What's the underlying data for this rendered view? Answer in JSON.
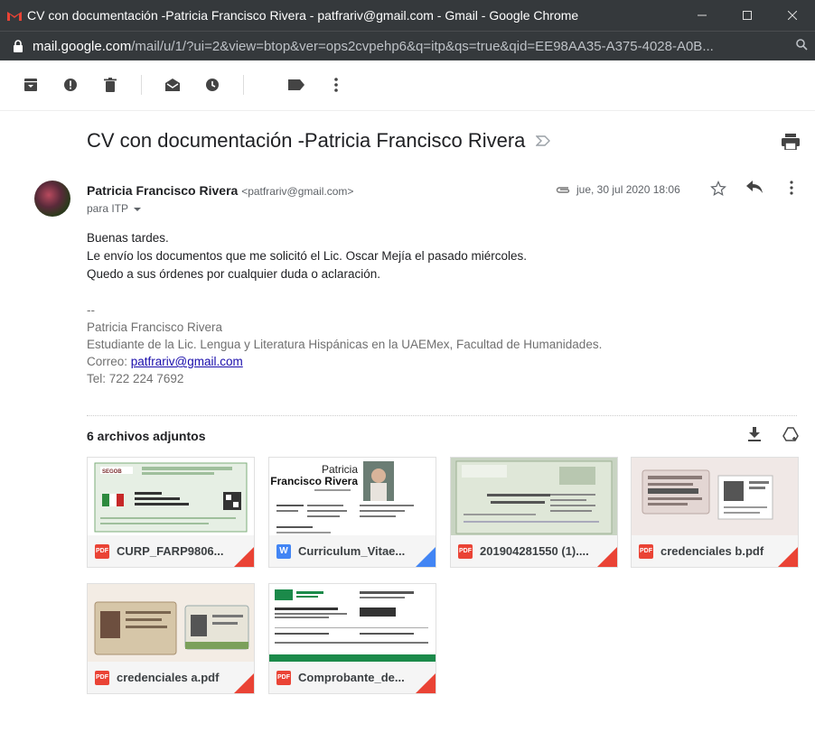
{
  "window": {
    "title": "CV con documentación -Patricia Francisco Rivera - patfrariv@gmail.com - Gmail - Google Chrome",
    "url_host": "mail.google.com",
    "url_path": "/mail/u/1/?ui=2&view=btop&ver=ops2cvpehp6&q=itp&qs=true&qid=EE98AA35-A375-4028-A0B..."
  },
  "toolbar": {
    "icons": [
      "archive-icon",
      "report-spam-icon",
      "delete-icon",
      "mark-unread-icon",
      "snooze-icon",
      "label-icon",
      "more-vert-icon"
    ]
  },
  "message": {
    "subject": "CV con documentación -Patricia Francisco Rivera",
    "sender_name": "Patricia Francisco Rivera",
    "sender_email": "<patfrariv@gmail.com>",
    "recipients": "para ITP",
    "date": "jue, 30 jul 2020 18:06",
    "body": {
      "line1": "Buenas tardes.",
      "line2": "Le envío los documentos que me solicitó el Lic. Oscar Mejía el pasado miércoles.",
      "line3": "Quedo a sus órdenes por cualquier duda o aclaración."
    },
    "signature": {
      "sep": "--",
      "name": "Patricia Francisco Rivera",
      "role": "Estudiante de la Lic. Lengua y Literatura Hispánicas en la UAEMex, Facultad de Humanidades.",
      "email_label": "Correo: ",
      "email": "patfrariv@gmail.com",
      "tel": "Tel: 722 224 7692"
    }
  },
  "attachments": {
    "title": "6 archivos adjuntos",
    "items": [
      {
        "name": "CURP_FARP9806...",
        "type": "PDF",
        "color": "#ea4335"
      },
      {
        "name": "Curriculum_Vitae...",
        "type": "W",
        "color": "#4285f4"
      },
      {
        "name": "201904281550 (1)....",
        "type": "PDF",
        "color": "#ea4335"
      },
      {
        "name": "credenciales b.pdf",
        "type": "PDF",
        "color": "#ea4335"
      },
      {
        "name": "credenciales a.pdf",
        "type": "PDF",
        "color": "#ea4335"
      },
      {
        "name": "Comprobante_de...",
        "type": "PDF",
        "color": "#ea4335"
      }
    ]
  },
  "thumb_text": {
    "cv_first": "Patricia",
    "cv_last": "Francisco Rivera"
  }
}
